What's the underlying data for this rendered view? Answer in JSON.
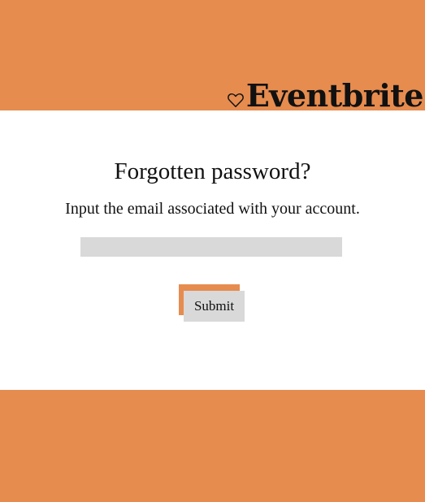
{
  "brand": {
    "icon": "heart-outline-icon",
    "name": "Eventbrite"
  },
  "form": {
    "title": "Forgotten password?",
    "subtitle": "Input the email associated with your account.",
    "email_value": "",
    "submit_label": "Submit"
  },
  "colors": {
    "accent": "#e68c4f",
    "input_background": "#d9d9d9",
    "text": "#111111",
    "background": "#ffffff"
  }
}
